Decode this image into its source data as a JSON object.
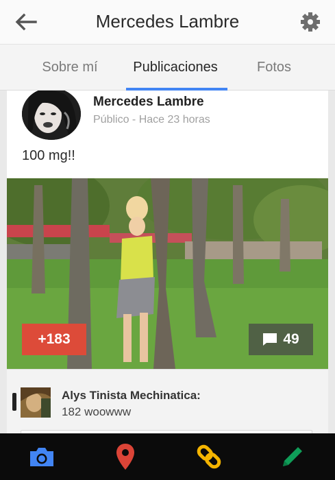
{
  "header": {
    "title": "Mercedes Lambre"
  },
  "tabs": [
    {
      "label": "Sobre mí"
    },
    {
      "label": "Publicaciones"
    },
    {
      "label": "Fotos"
    }
  ],
  "post": {
    "author": "Mercedes Lambre",
    "meta": "Público - Hace 23 horas",
    "text": "100 mg!!",
    "plus_count": "+183",
    "comment_count": "49"
  },
  "comment": {
    "author": "Alys Tinista Mechinatica:",
    "text": "182 woowww"
  },
  "bottom_bar": {
    "icons": [
      "camera-icon",
      "location-pin-icon",
      "link-icon",
      "pencil-icon"
    ],
    "colors": {
      "camera": "#4285f4",
      "location": "#db4437",
      "link": "#f4b400",
      "pencil": "#0f9d58"
    }
  },
  "colors": {
    "accent": "#4285f4",
    "plus_one": "#dd4b39"
  }
}
